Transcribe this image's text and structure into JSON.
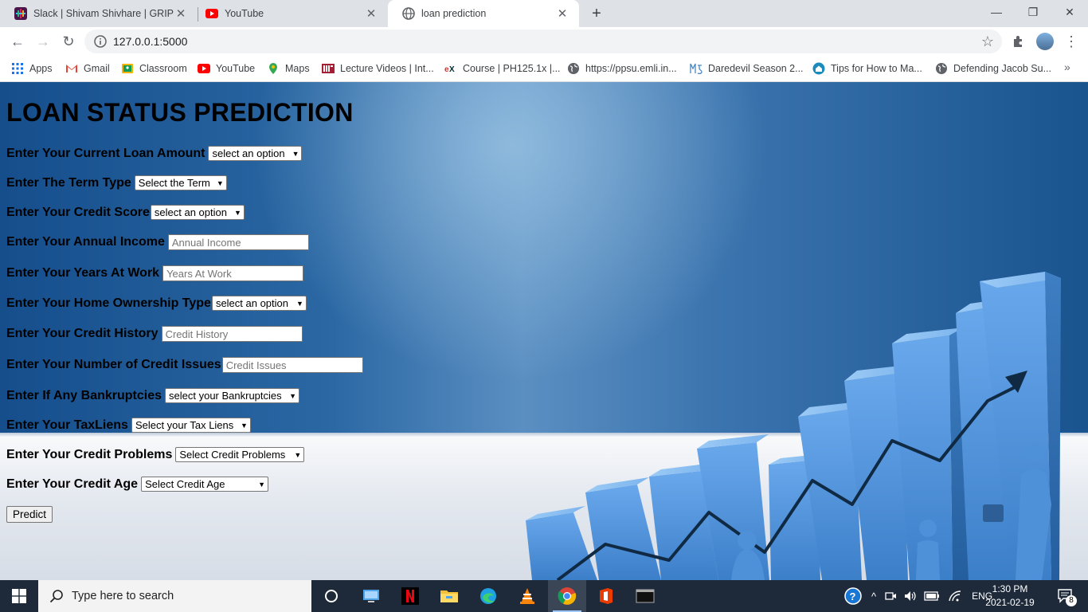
{
  "browser": {
    "tabs": [
      {
        "title": "Slack | Shivam Shivhare | GRIP - F",
        "close": "✕"
      },
      {
        "title": "YouTube",
        "close": "✕"
      },
      {
        "title": "loan prediction",
        "close": "✕"
      }
    ],
    "new_tab": "+",
    "window_controls": {
      "minimize": "—",
      "maximize": "❐",
      "close": "✕"
    },
    "nav": {
      "back": "←",
      "forward": "→",
      "reload": "↻"
    },
    "url": "127.0.0.1:5000",
    "bookmark_star": "☆",
    "menu": "⋮",
    "bookmarks": [
      {
        "label": "Apps"
      },
      {
        "label": "Gmail"
      },
      {
        "label": "Classroom"
      },
      {
        "label": "YouTube"
      },
      {
        "label": "Maps"
      },
      {
        "label": "Lecture Videos | Int..."
      },
      {
        "label": "Course | PH125.1x |..."
      },
      {
        "label": "https://ppsu.emli.in..."
      },
      {
        "label": "Daredevil Season 2..."
      },
      {
        "label": "Tips for How to Ma..."
      },
      {
        "label": "Defending Jacob Su..."
      }
    ],
    "bookmarks_more": "»",
    "colors": {
      "tabstrip": "#dee1e6",
      "toolbar": "#ffffff"
    }
  },
  "page": {
    "title": "LOAN STATUS PREDICTION",
    "fields": {
      "loan_amount": {
        "label": "Enter Your Current Loan Amount",
        "value": "select an option"
      },
      "term": {
        "label": "Enter The Term Type",
        "value": "Select the Term"
      },
      "credit_score": {
        "label": "Enter Your Credit Score",
        "value": "select an option"
      },
      "annual_income": {
        "label": "Enter Your Annual Income",
        "placeholder": "Annual Income"
      },
      "years_at_work": {
        "label": "Enter Your Years At Work",
        "placeholder": "Years At Work"
      },
      "home_ownership": {
        "label": "Enter Your Home Ownership Type",
        "value": "select an option"
      },
      "credit_history": {
        "label": "Enter Your Credit History",
        "placeholder": "Credit History"
      },
      "credit_issues": {
        "label": "Enter Your Number of Credit Issues",
        "placeholder": "Credit Issues"
      },
      "bankruptcies": {
        "label": "Enter If Any Bankruptcies",
        "value": "select your Bankruptcies"
      },
      "tax_liens": {
        "label": "Enter Your TaxLiens",
        "value": "Select your Tax Liens"
      },
      "credit_problems": {
        "label": "Enter Your Credit Problems",
        "value": "Select Credit Problems"
      },
      "credit_age": {
        "label": "Enter Your Credit Age",
        "value": "Select Credit Age"
      }
    },
    "predict_button": "Predict",
    "colors": {
      "background_blue": "#2a67a3",
      "bars": "#5b9be0"
    }
  },
  "taskbar": {
    "search_placeholder": "Type here to search",
    "apps": [
      "task-view",
      "file-explorer-pc",
      "netflix",
      "file-explorer",
      "edge",
      "vlc",
      "chrome",
      "office",
      "terminal"
    ],
    "tray": {
      "language": "ENG",
      "notifications": "8"
    },
    "clock": {
      "time": "1:30 PM",
      "date": "2021-02-19"
    }
  }
}
